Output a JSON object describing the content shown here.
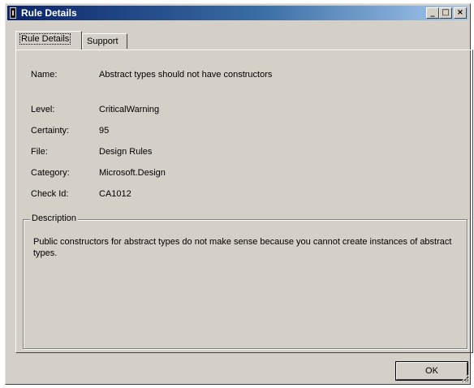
{
  "window": {
    "title": "Rule Details",
    "minimize_glyph": "_",
    "maximize_glyph": "□",
    "close_glyph": "×"
  },
  "tabs": [
    {
      "label": "Rule Details",
      "active": true
    },
    {
      "label": "Support",
      "active": false
    }
  ],
  "fields": {
    "name": {
      "label": "Name:",
      "value": "Abstract types should not have constructors"
    },
    "level": {
      "label": "Level:",
      "value": "CriticalWarning"
    },
    "certainty": {
      "label": "Certainty:",
      "value": "95"
    },
    "file": {
      "label": "File:",
      "value": "Design Rules"
    },
    "category": {
      "label": "Category:",
      "value": "Microsoft.Design"
    },
    "check_id": {
      "label": "Check Id:",
      "value": "CA1012"
    }
  },
  "description": {
    "label": "Description",
    "text": "Public constructors for abstract types do not make sense because you cannot create instances of abstract types."
  },
  "buttons": {
    "ok_label": "OK"
  },
  "colors": {
    "window_face": "#d4d0c8",
    "titlebar_start": "#0a246a",
    "titlebar_end": "#a6caf0"
  }
}
